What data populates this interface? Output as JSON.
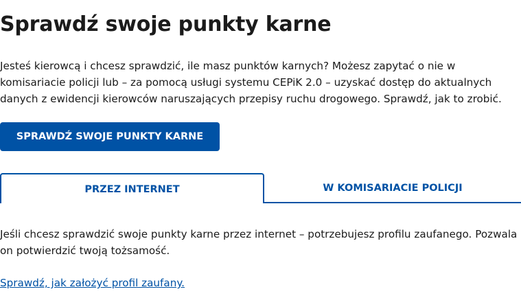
{
  "page": {
    "title": "Sprawdź swoje punkty karne",
    "intro": "Jesteś kierowcą i chcesz sprawdzić, ile masz punktów karnych? Możesz zapytać o nie w komisariacie policji lub – za pomocą usługi systemu CEPiK 2.0 – uzyskać dostęp do aktualnych danych z ewidencji kierowców naruszających przepisy ruchu drogowego. Sprawdź, jak to zrobić."
  },
  "cta": {
    "label": "SPRAWDŹ SWOJE PUNKTY KARNE"
  },
  "tabs": [
    {
      "label": "PRZEZ INTERNET",
      "active": true
    },
    {
      "label": "W KOMISARIACIE POLICJI",
      "active": false
    }
  ],
  "panel": {
    "text": "Jeśli chcesz sprawdzić swoje punkty karne przez internet – potrzebujesz profilu zaufanego. Pozwala on potwierdzić twoją tożsamość.",
    "link": "Sprawdź, jak założyć profil zaufany."
  },
  "colors": {
    "primary": "#0052a5",
    "text": "#1b1b1b",
    "background": "#ffffff"
  }
}
